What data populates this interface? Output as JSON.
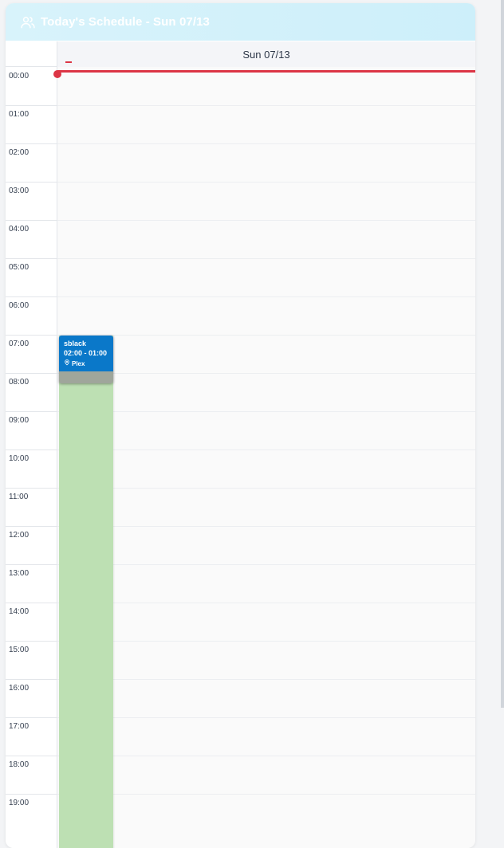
{
  "header": {
    "title": "Today's Schedule - Sun 07/13",
    "icon": "users-icon"
  },
  "day": {
    "label": "Sun 07/13"
  },
  "times": [
    "00:00",
    "01:00",
    "02:00",
    "03:00",
    "04:00",
    "05:00",
    "06:00",
    "07:00",
    "08:00",
    "09:00",
    "10:00",
    "11:00",
    "12:00",
    "13:00",
    "14:00",
    "15:00",
    "16:00",
    "17:00",
    "18:00",
    "19:00"
  ],
  "event": {
    "user": "sblack",
    "time": "02:00 - 01:00",
    "location": "Plex",
    "location_icon": "map-pin-icon",
    "colors": {
      "header": "#0a78c9",
      "fill": "#bde0b3"
    }
  },
  "colors": {
    "now_line": "#dc3545",
    "header_bg": "#d8f3fb"
  }
}
